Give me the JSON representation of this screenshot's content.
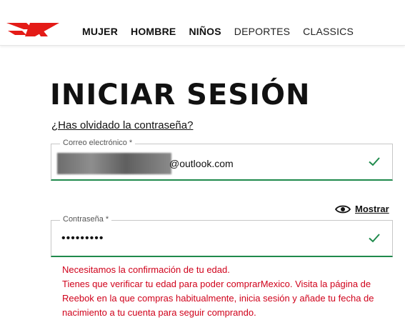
{
  "nav": {
    "items": [
      {
        "label": "MUJER"
      },
      {
        "label": "HOMBRE"
      },
      {
        "label": "NIÑOS"
      },
      {
        "label": "DEPORTES"
      },
      {
        "label": "CLASSICS"
      }
    ]
  },
  "page": {
    "title": "INICIAR SESIÓN",
    "forgot_link": "¿Has olvidado la contraseña?"
  },
  "email": {
    "label": "Correo electrónico *",
    "domain": "@outlook.com"
  },
  "password": {
    "label": "Contraseña *",
    "value": "•••••••••",
    "show_label": "Mostrar"
  },
  "error": {
    "line1": "Necesitamos la confirmación de tu edad.",
    "line2": "Tienes que verificar tu edad para poder comprarMexico. Visita la página de Reebok en la que compras habitualmente, inicia sesión y añade tu fecha de nacimiento a tu cuenta para seguir comprando."
  },
  "colors": {
    "accent_green": "#1f8a4c",
    "error_red": "#d0021b",
    "brand_red": "#e41b17"
  },
  "icons": [
    "reebok-logo",
    "checkmark-icon",
    "eye-icon"
  ]
}
